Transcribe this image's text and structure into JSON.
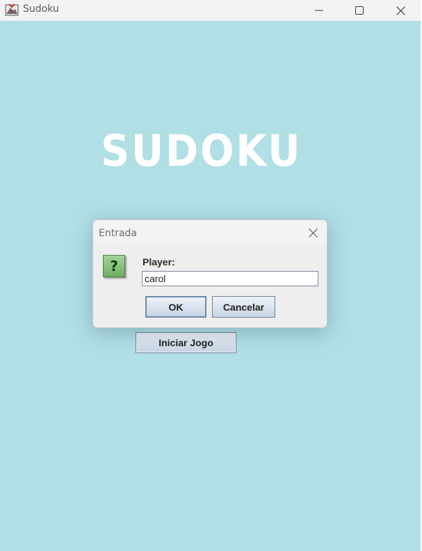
{
  "window": {
    "title": "Sudoku",
    "icon": "sudoku-app-icon",
    "controls": [
      "minimize-icon",
      "maximize-icon",
      "close-icon"
    ]
  },
  "main": {
    "logo_text": "SUDOKU",
    "start_button_label": "Iniciar Jogo",
    "background_color": "#b0dfe5"
  },
  "dialog": {
    "title": "Entrada",
    "icon": "question-icon",
    "icon_glyph": "?",
    "field_label": "Player:",
    "field_value": "carol",
    "ok_label": "OK",
    "cancel_label": "Cancelar"
  }
}
